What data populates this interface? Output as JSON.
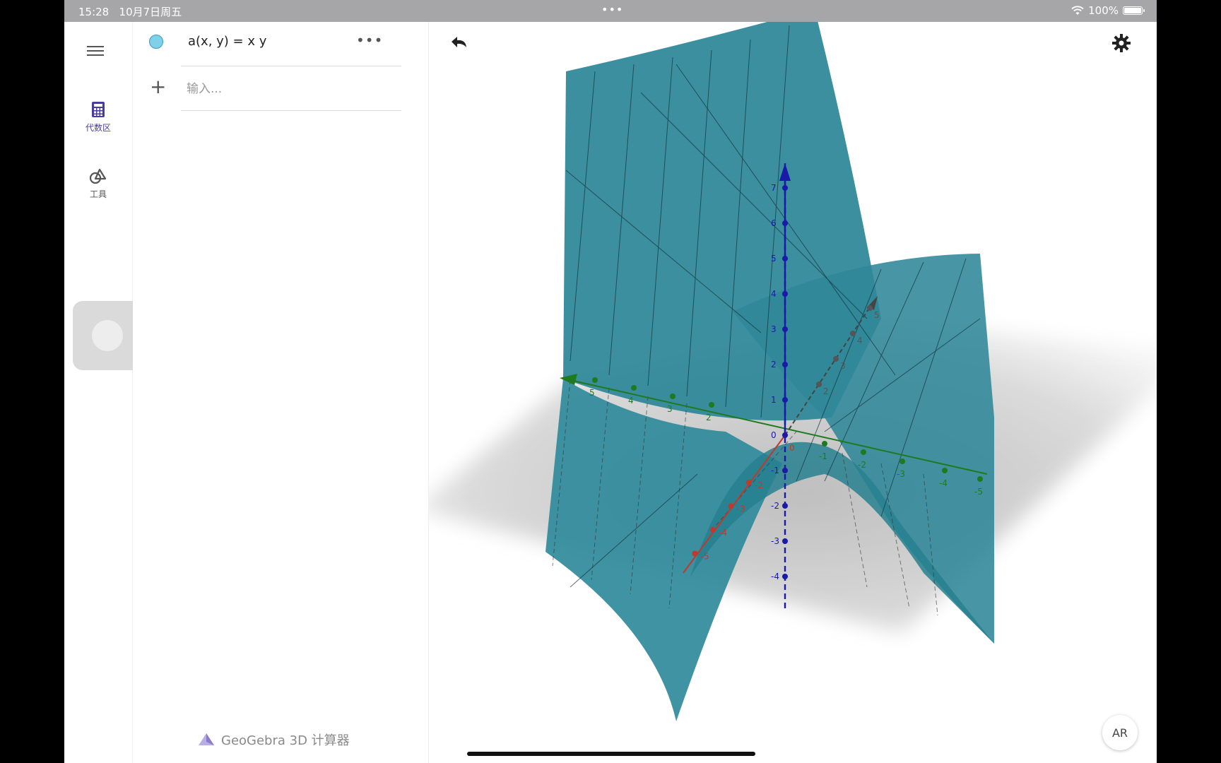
{
  "status_bar": {
    "time": "15:28",
    "date": "10月7日周五",
    "battery": "100%"
  },
  "rail": {
    "items": [
      {
        "id": "algebra",
        "label": "代数区",
        "icon": "calculator-icon"
      },
      {
        "id": "tools",
        "label": "工具",
        "icon": "shapes-icon"
      }
    ]
  },
  "algebra": {
    "expression": "a(x, y) = x y",
    "input_placeholder": "输入..."
  },
  "app": {
    "brand": "GeoGebra 3D 计算器"
  },
  "view3d": {
    "ar_label": "AR",
    "z_ticks": [
      "7",
      "6",
      "5",
      "4",
      "3",
      "2",
      "1",
      "0",
      "-1",
      "-2",
      "-3",
      "-4"
    ],
    "y_ticks": [
      "5",
      "4",
      "3",
      "2",
      "-1",
      "-2",
      "-3",
      "-4",
      "-5"
    ],
    "x_ticks": [
      "-2",
      "-3",
      "-4",
      "-5"
    ],
    "x_pos_ticks": [
      "2",
      "3",
      "4",
      "5"
    ],
    "origin": "0"
  },
  "colors": {
    "surface": "#2a7f8f",
    "x_axis": "#c0392b",
    "y_axis": "#1e7a1e",
    "z_axis": "#1a1aa8",
    "accent": "#4a3c9c"
  }
}
